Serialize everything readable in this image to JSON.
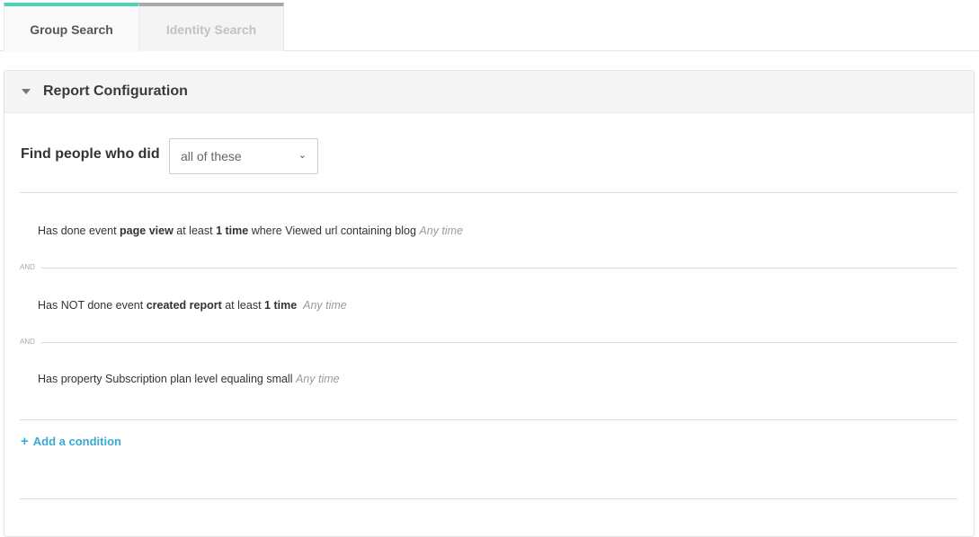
{
  "tabs": {
    "group_search": "Group Search",
    "identity_search": "Identity Search"
  },
  "panel": {
    "title": "Report Configuration"
  },
  "find": {
    "label": "Find people who did",
    "selected": "all of these"
  },
  "conditions": [
    {
      "prefix": "Has done event",
      "event": "page view",
      "mid": "at least",
      "count": "1 time",
      "suffix": "where Viewed url containing blog",
      "time": "Any time"
    },
    {
      "prefix": "Has NOT done event",
      "event": "created report",
      "mid": "at least",
      "count": "1 time",
      "time": "Any time"
    },
    {
      "text": "Has property Subscription plan level equaling small",
      "time": "Any time"
    }
  ],
  "connectors": [
    "AND",
    "AND"
  ],
  "add_condition": {
    "icon": "+",
    "label": "Add a condition"
  },
  "colors": {
    "active_tab_accent": "#4fd1b5",
    "link": "#3aa9d6"
  }
}
